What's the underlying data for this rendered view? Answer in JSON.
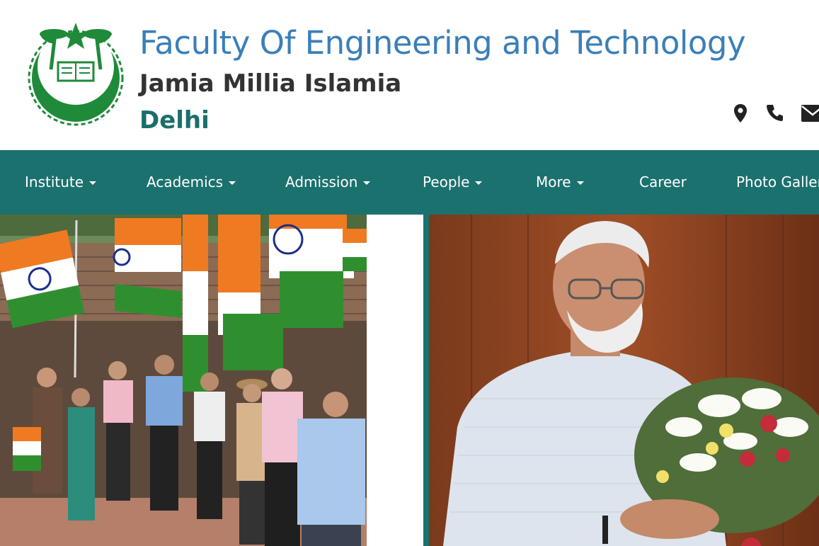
{
  "header": {
    "title": "Faculty Of Engineering and Technology",
    "subtitle": "Jamia Millia Islamia",
    "city": "Delhi",
    "logo_icon": "jmi-emblem-icon",
    "contact_icons": [
      "map-marker-icon",
      "phone-icon",
      "envelope-icon"
    ]
  },
  "nav": {
    "items": [
      {
        "label": "Institute",
        "dropdown": true
      },
      {
        "label": "Academics",
        "dropdown": true
      },
      {
        "label": "Admission",
        "dropdown": true
      },
      {
        "label": "People",
        "dropdown": true
      },
      {
        "label": "More",
        "dropdown": true
      },
      {
        "label": "Career",
        "dropdown": false
      },
      {
        "label": "Photo Gallery",
        "dropdown": false
      }
    ]
  },
  "colors": {
    "nav_background": "#1b716e",
    "title_blue": "#3b7fb8",
    "city_teal": "#1a6f6c",
    "subtitle_dark": "#333333"
  },
  "carousel": {
    "slides": [
      "flag-rally-photo",
      "dignitary-bouquet-photo"
    ]
  }
}
